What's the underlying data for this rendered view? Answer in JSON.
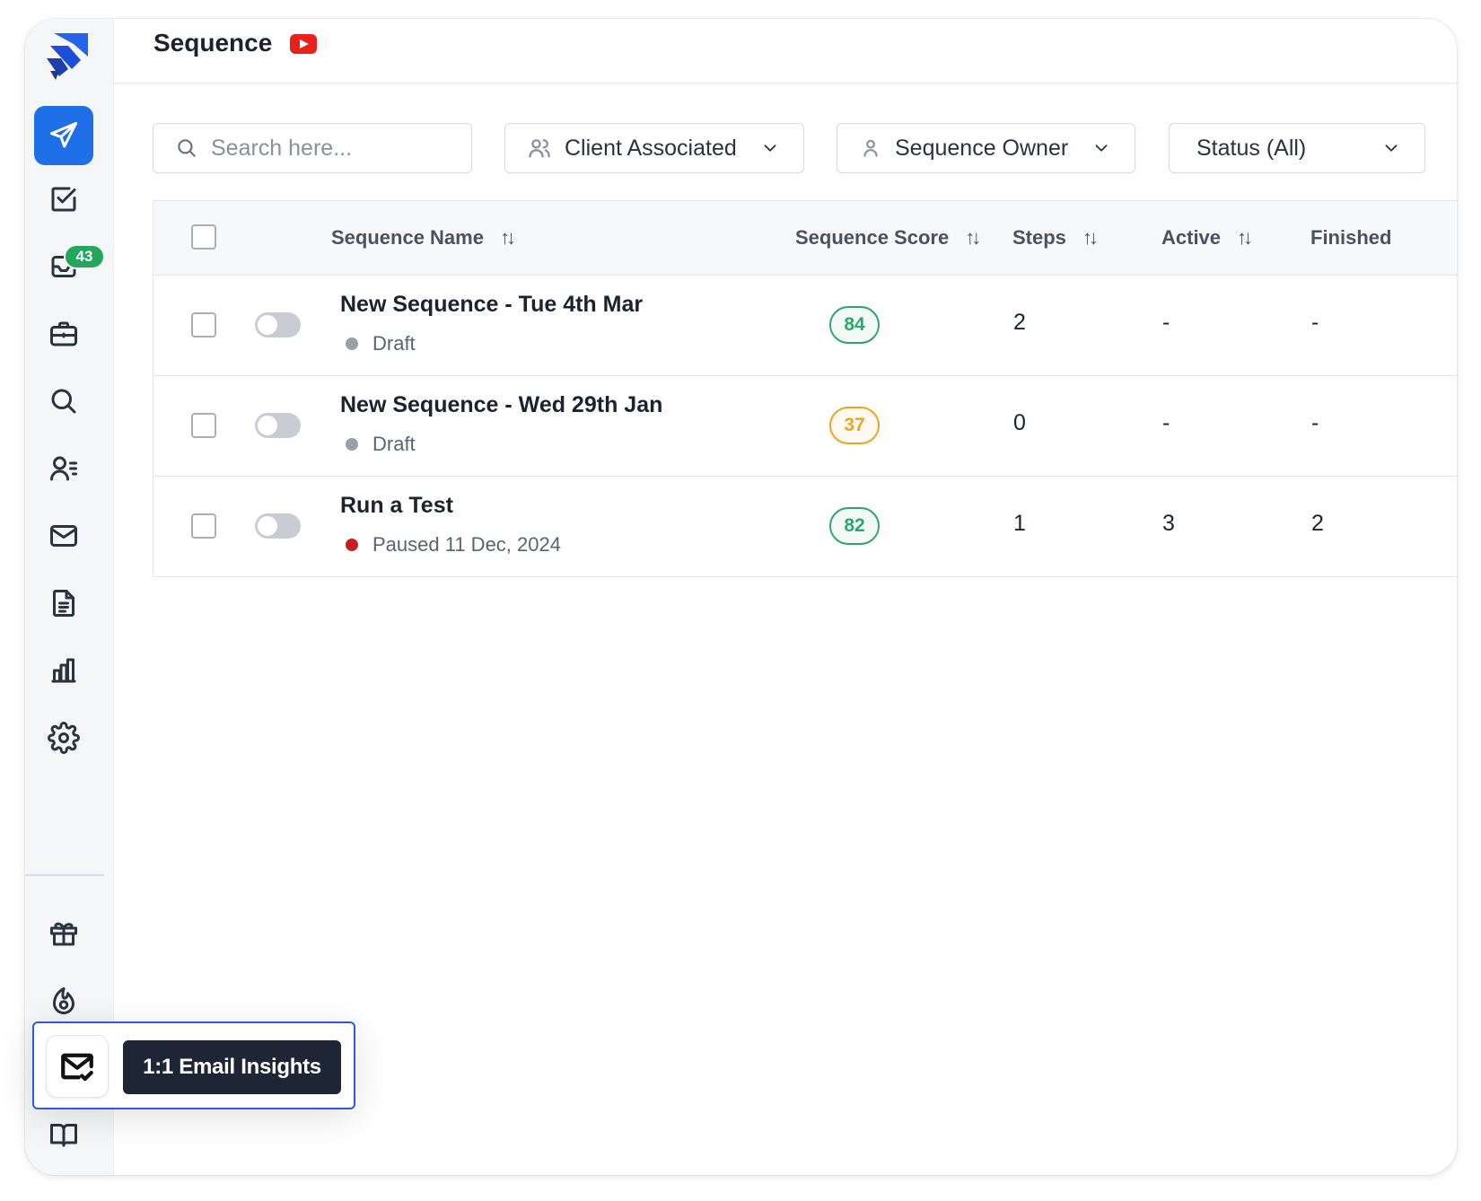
{
  "header": {
    "title": "Sequence",
    "video_icon": "youtube-icon"
  },
  "sidebar": {
    "logo": "app-logo",
    "notification_count": "43",
    "items": [
      {
        "name": "sequences",
        "icon": "paper-plane-icon",
        "active": true
      },
      {
        "name": "tasks",
        "icon": "checkbox-icon"
      },
      {
        "name": "inbox",
        "icon": "inbox-icon"
      },
      {
        "name": "deals",
        "icon": "briefcase-icon"
      },
      {
        "name": "prospect-search",
        "icon": "search-icon"
      },
      {
        "name": "contacts",
        "icon": "contact-list-icon"
      },
      {
        "name": "email",
        "icon": "mail-icon"
      },
      {
        "name": "templates",
        "icon": "document-icon"
      },
      {
        "name": "reports",
        "icon": "bar-chart-icon"
      },
      {
        "name": "settings",
        "icon": "gear-icon"
      },
      {
        "name": "rewards",
        "icon": "gift-icon"
      },
      {
        "name": "warmup",
        "icon": "fire-icon"
      },
      {
        "name": "email-insights",
        "icon": "mail-check-icon"
      },
      {
        "name": "help",
        "icon": "book-icon"
      }
    ],
    "tooltip": "1:1 Email Insights"
  },
  "filters": {
    "search_placeholder": "Search here...",
    "client": "Client Associated",
    "owner": "Sequence Owner",
    "status": "Status (All)"
  },
  "table": {
    "columns": {
      "name": "Sequence Name",
      "score": "Sequence Score",
      "steps": "Steps",
      "active": "Active",
      "finished": "Finished"
    },
    "sort_glyph": "↑↓",
    "rows": [
      {
        "name": "New Sequence - Tue 4th Mar",
        "status": "Draft",
        "status_color": "#9a9fa8",
        "score": "84",
        "score_color": "#2fa66b",
        "steps": "2",
        "active": "-",
        "finished": "-"
      },
      {
        "name": "New Sequence - Wed 29th Jan",
        "status": "Draft",
        "status_color": "#9a9fa8",
        "score": "37",
        "score_color": "#eca51f",
        "steps": "0",
        "active": "-",
        "finished": "-"
      },
      {
        "name": "Run a Test",
        "status": "Paused 11 Dec, 2024",
        "status_color": "#c4201f",
        "score": "82",
        "score_color": "#2fa66b",
        "steps": "1",
        "active": "3",
        "finished": "2"
      }
    ]
  }
}
